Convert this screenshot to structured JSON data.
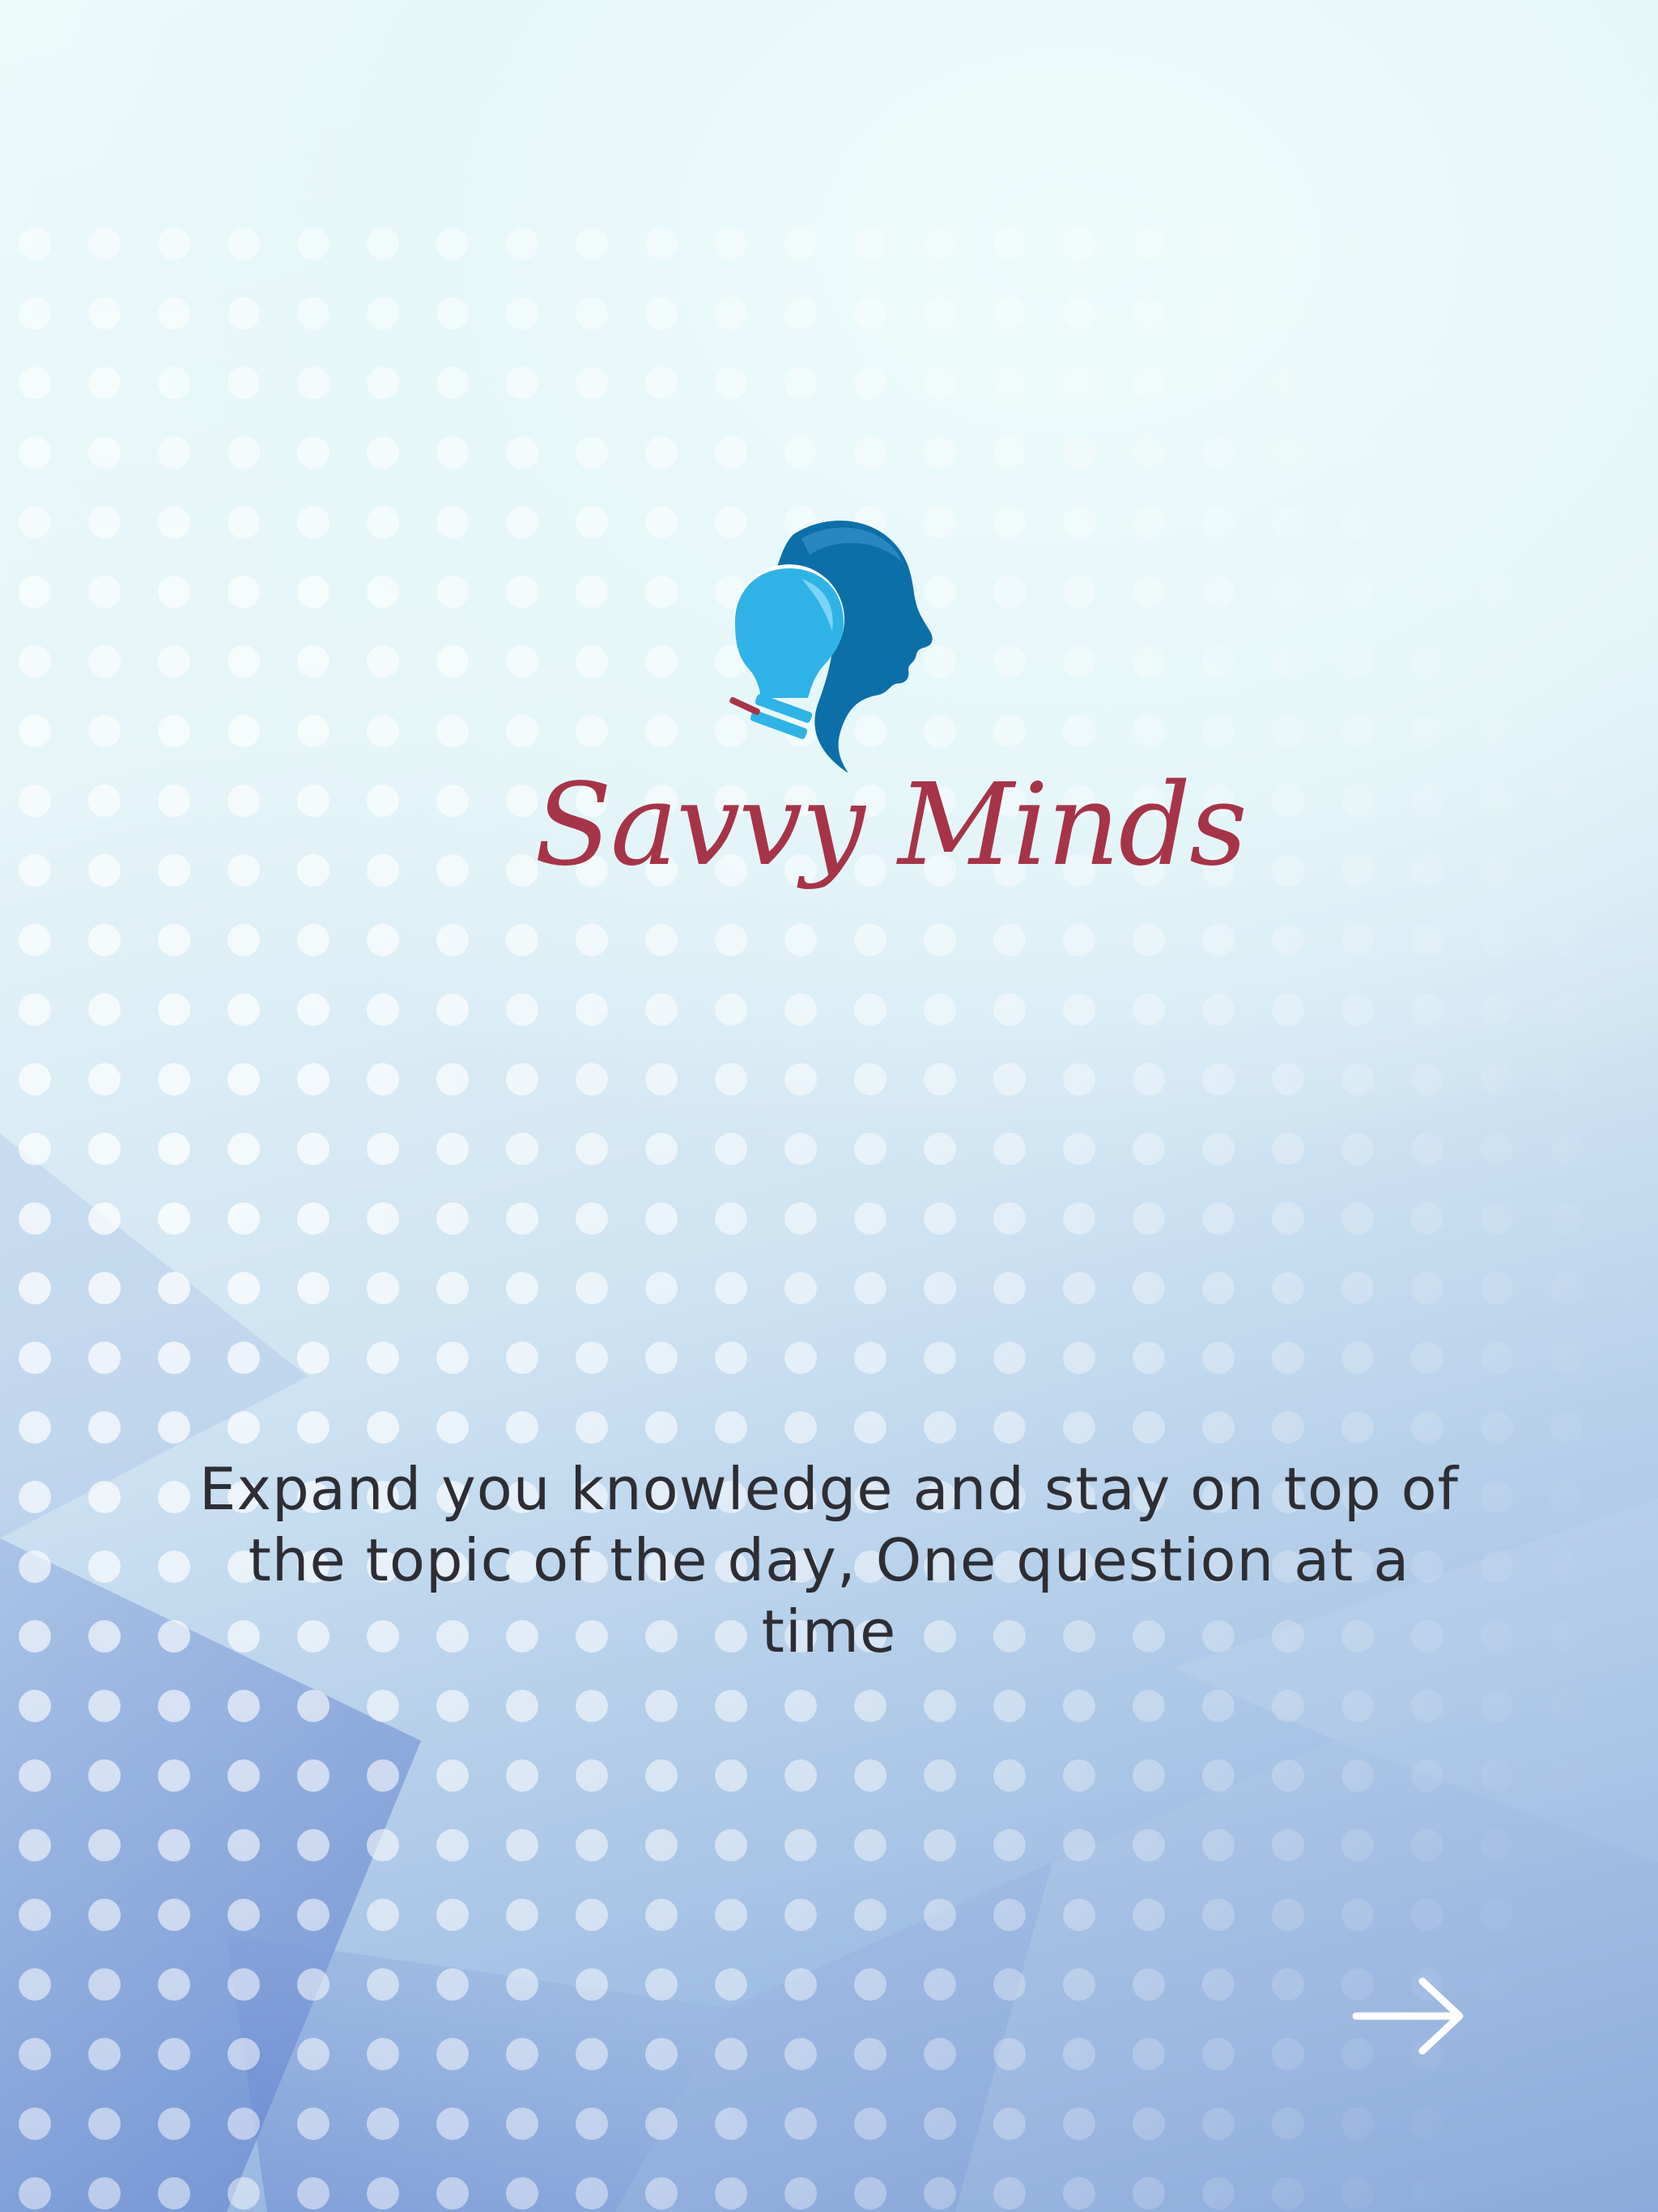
{
  "app": {
    "logo_text": "Savvy Minds",
    "logo_icon": "head-lightbulb-icon"
  },
  "onboarding": {
    "tagline": "Expand you knowledge and stay on top of the topic of the day, One question at a time",
    "next_icon": "arrow-right-icon"
  },
  "colors": {
    "brand_text": "#a63448",
    "brand_blue_dark": "#0d6fa8",
    "brand_blue_light": "#2fb3e6",
    "tagline_text": "#2d2d33",
    "arrow": "#ffffff"
  }
}
